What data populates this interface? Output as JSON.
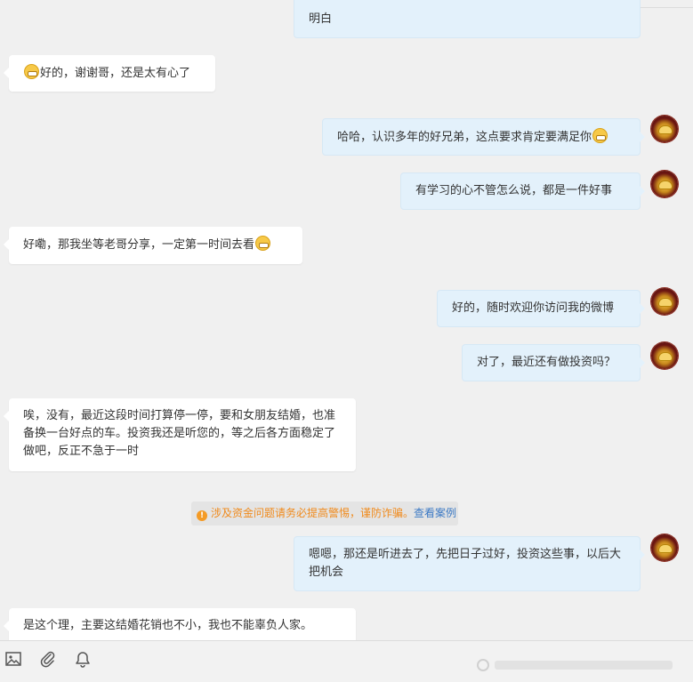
{
  "messages": [
    {
      "id": "m1",
      "side": "right",
      "text": "明白",
      "emoji_after": false
    },
    {
      "id": "m2",
      "side": "left",
      "text": "好的，谢谢哥，还是太有心了",
      "emoji_before": true
    },
    {
      "id": "m3",
      "side": "right",
      "text": "哈哈，认识多年的好兄弟，这点要求肯定要满足你",
      "emoji_after": true
    },
    {
      "id": "m4",
      "side": "right",
      "text": "有学习的心不管怎么说，都是一件好事"
    },
    {
      "id": "m5",
      "side": "left",
      "text": "好嘞，那我坐等老哥分享，一定第一时间去看",
      "emoji_after": true
    },
    {
      "id": "m6",
      "side": "right",
      "text": "好的，随时欢迎你访问我的微博"
    },
    {
      "id": "m7",
      "side": "right",
      "text": "对了，最近还有做投资吗？"
    },
    {
      "id": "m8",
      "side": "left",
      "text": "唉，没有，最近这段时间打算停一停，要和女朋友结婚，也准备换一台好点的车。投资我还是听您的，等之后各方面稳定了做吧，反正不急于一时"
    },
    {
      "id": "m9",
      "side": "right",
      "text": "嗯嗯，那还是听进去了，先把日子过好，投资这些事，以后大把机会"
    },
    {
      "id": "m10",
      "side": "left",
      "text": "是这个理，主要这结婚花销也不小，我也不能辜负人家。"
    }
  ],
  "notice": {
    "icon": "warning-icon",
    "text": "涉及资金问题请务必提高警惕，谨防诈骗。",
    "link": "查看案例",
    "text_color": "#f08a1c",
    "link_color": "#3b79c4"
  },
  "toolbar": {
    "icons": [
      "image-icon",
      "attachment-icon",
      "bell-icon"
    ]
  },
  "colors": {
    "background": "#f0f0f0",
    "bubble_left": "#ffffff",
    "bubble_right": "#e3f1fb"
  }
}
